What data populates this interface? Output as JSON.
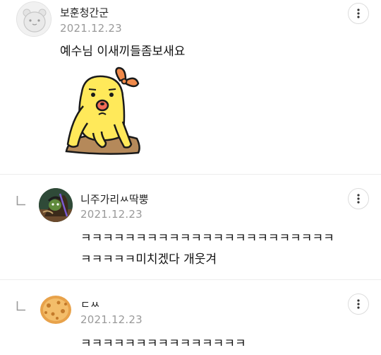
{
  "comments": [
    {
      "username": "보훈청간군",
      "date": "2021.12.23",
      "lines": [
        "예수님 이새끼들좀보새요"
      ],
      "avatar_icon": "default-profile-icon",
      "has_sticker": true,
      "is_reply": false
    },
    {
      "username": "니주가리ㅆ딱뿡",
      "date": "2021.12.23",
      "lines": [
        "ㅋㅋㅋㅋㅋㅋㅋㅋㅋㅋㅋㅋㅋㅋㅋㅋㅋㅋㅋㅋㅋㅋㅋ",
        "ㅋㅋㅋㅋㅋ미치겠다 개웃겨"
      ],
      "avatar_icon": "character-avatar-icon",
      "is_reply": true
    },
    {
      "username": "ㄷㅆ",
      "date": "2021.12.23",
      "lines": [
        "ㅋㅋㅋㅋㅋㅋㅋㅋㅋㅋㅋㅋㅋㅋㅋ"
      ],
      "avatar_icon": "cookie-avatar-icon",
      "is_reply": true
    }
  ],
  "icons": {
    "more": "more-vertical-icon",
    "reply": "reply-arrow-icon"
  },
  "colors": {
    "date": "#9a9a9a",
    "sticker_yellow": "#ffe95a",
    "sticker_bow": "#f08a4b",
    "sticker_ground": "#b5895a"
  }
}
